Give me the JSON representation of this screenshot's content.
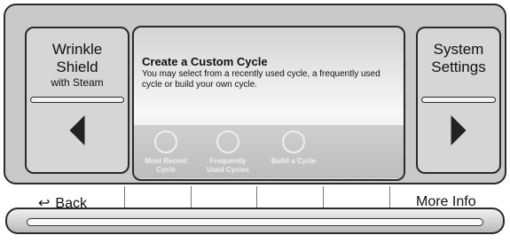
{
  "left_button": {
    "title_line1": "Wrinkle",
    "title_line2": "Shield",
    "subtitle": "with Steam"
  },
  "right_button": {
    "title_line1": "System",
    "title_line2": "Settings"
  },
  "screen": {
    "title": "Create a Custom Cycle",
    "body": "You may select from a recently used cycle, a frequently used cycle or build your own cycle.",
    "options": [
      {
        "label_line1": "Most Recent",
        "label_line2": "Cycle"
      },
      {
        "label_line1": "Frequently",
        "label_line2": "Used Cycles"
      },
      {
        "label_line1": "Build a Cycle",
        "label_line2": ""
      }
    ]
  },
  "bottom": {
    "back_label": "Back",
    "more_info_label": "More Info"
  },
  "icons": {
    "back": "back-arrow-icon",
    "left": "left-arrow-icon",
    "right": "right-arrow-icon",
    "option": "ring-icon"
  }
}
